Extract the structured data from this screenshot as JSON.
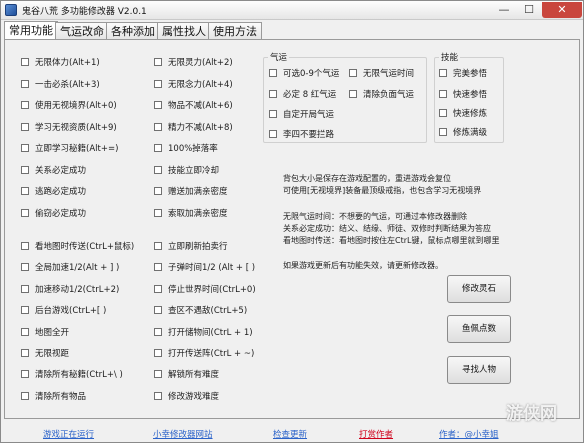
{
  "window": {
    "title": "鬼谷八荒 多功能修改器  V2.0.1",
    "minimize": "—",
    "maximize": "☐",
    "close": "✕"
  },
  "tabs": [
    "常用功能",
    "气运改命",
    "各种添加",
    "属性找人",
    "使用方法"
  ],
  "left_options": [
    "无限体力(Alt+1)",
    "一击必杀(Alt+3)",
    "使用无视境界(Alt+0)",
    "学习无视资质(Alt+9)",
    "立即学习秘籍(Alt+=)",
    "关系必定成功",
    "逃跑必定成功",
    "偷窃必定成功",
    "看地图时传送(CtrL+鼠标)",
    "全局加速1/2(Alt + ] )",
    "加速移动1/2(CtrL+2)",
    "后台游戏(CtrL+[ )",
    "地图全开",
    "无限视距",
    "清除所有秘籍(CtrL+\\ )",
    "清除所有物品"
  ],
  "mid_options": [
    "无限灵力(Alt+2)",
    "无限念力(Alt+4)",
    "物品不减(Alt+6)",
    "精力不减(Alt+8)",
    "100%掉落率",
    "技能立即冷却",
    "赠送加满亲密度",
    "索取加满亲密度",
    "立即刷新拍卖行",
    "子弹时间1/2 (Alt + [ )",
    "停止世界时间(CtrL+0)",
    "查区不遇敌(CtrL+5)",
    "打开储物间(CtrL + 1)",
    "打开传送阵(CtrL + ~)",
    "解锁所有难度",
    "修改游戏难度"
  ],
  "luck": {
    "title": "气运",
    "options": [
      "可选0-9个气运",
      "无限气运时间",
      "必定 8 红气运",
      "清除负面气运",
      "自定开局气运",
      "李四不要拦路"
    ]
  },
  "skills": {
    "title": "技能",
    "options": [
      "完美参悟",
      "快速参悟",
      "快速修炼",
      "修炼满级"
    ]
  },
  "info_lines": [
    "背包大小是保存在游戏配置的，重进游戏会复位",
    "可使用[无视境界]装备最顶级戒指，也包含学习无视境界",
    "无限气运时间：不想要的气运，可通过本修改器删除",
    "关系必定成功：结义、结缘、师徒、双修时判断结果为答应",
    "看地图时传送：看地图时按住左CtrL键，鼠标点哪里就到哪里",
    "如果游戏更新后有功能失效，请更新修改器。"
  ],
  "buttons": [
    "修改灵石",
    "鱼佩点数",
    "寻找人物"
  ],
  "footer": {
    "status": "游戏正在运行",
    "site": "小幸修改器网站",
    "update": "检查更新",
    "tip": "打赏作者",
    "author": "作者：@小幸姐"
  },
  "watermark": "游侠网",
  "colors": {
    "footer_link": "#2a62c9",
    "tip_link": "#d0021b"
  }
}
